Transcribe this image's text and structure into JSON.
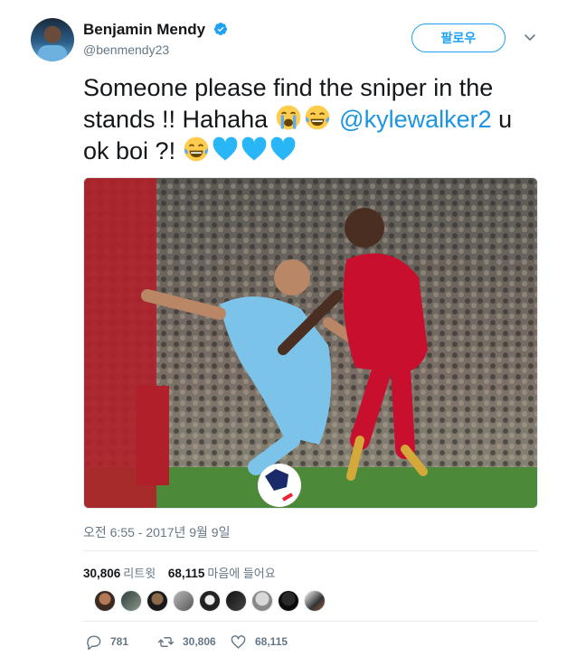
{
  "user": {
    "name": "Benjamin Mendy",
    "handle": "@benmendy23",
    "verified": true
  },
  "follow_button": {
    "label": "팔로우"
  },
  "tweet": {
    "text_before": "Someone please find the sniper in the stands !! Hahaha ",
    "mention": "@kylewalker2",
    "text_after": " u ok boi ?! ",
    "emojis_1": [
      "crying-face-emoji",
      "tears-of-joy-emoji"
    ],
    "emojis_2": [
      "tears-of-joy-emoji",
      "blue-heart-emoji",
      "blue-heart-emoji",
      "blue-heart-emoji"
    ]
  },
  "timestamp": "오전 6:55 - 2017년 9월 9일",
  "stats": {
    "retweets_count": "30,806",
    "retweets_label": "리트윗",
    "likes_count": "68,115",
    "likes_label": "마음에 들어요"
  },
  "likers_count_shown": 9,
  "actions": {
    "replies": "781",
    "retweets": "30,806",
    "likes": "68,115"
  },
  "colors": {
    "accent": "#1da1f2",
    "link": "#1b95e0",
    "muted": "#657786",
    "city_blue": "#6cb1e0",
    "liverpool_red": "#c8102e"
  }
}
